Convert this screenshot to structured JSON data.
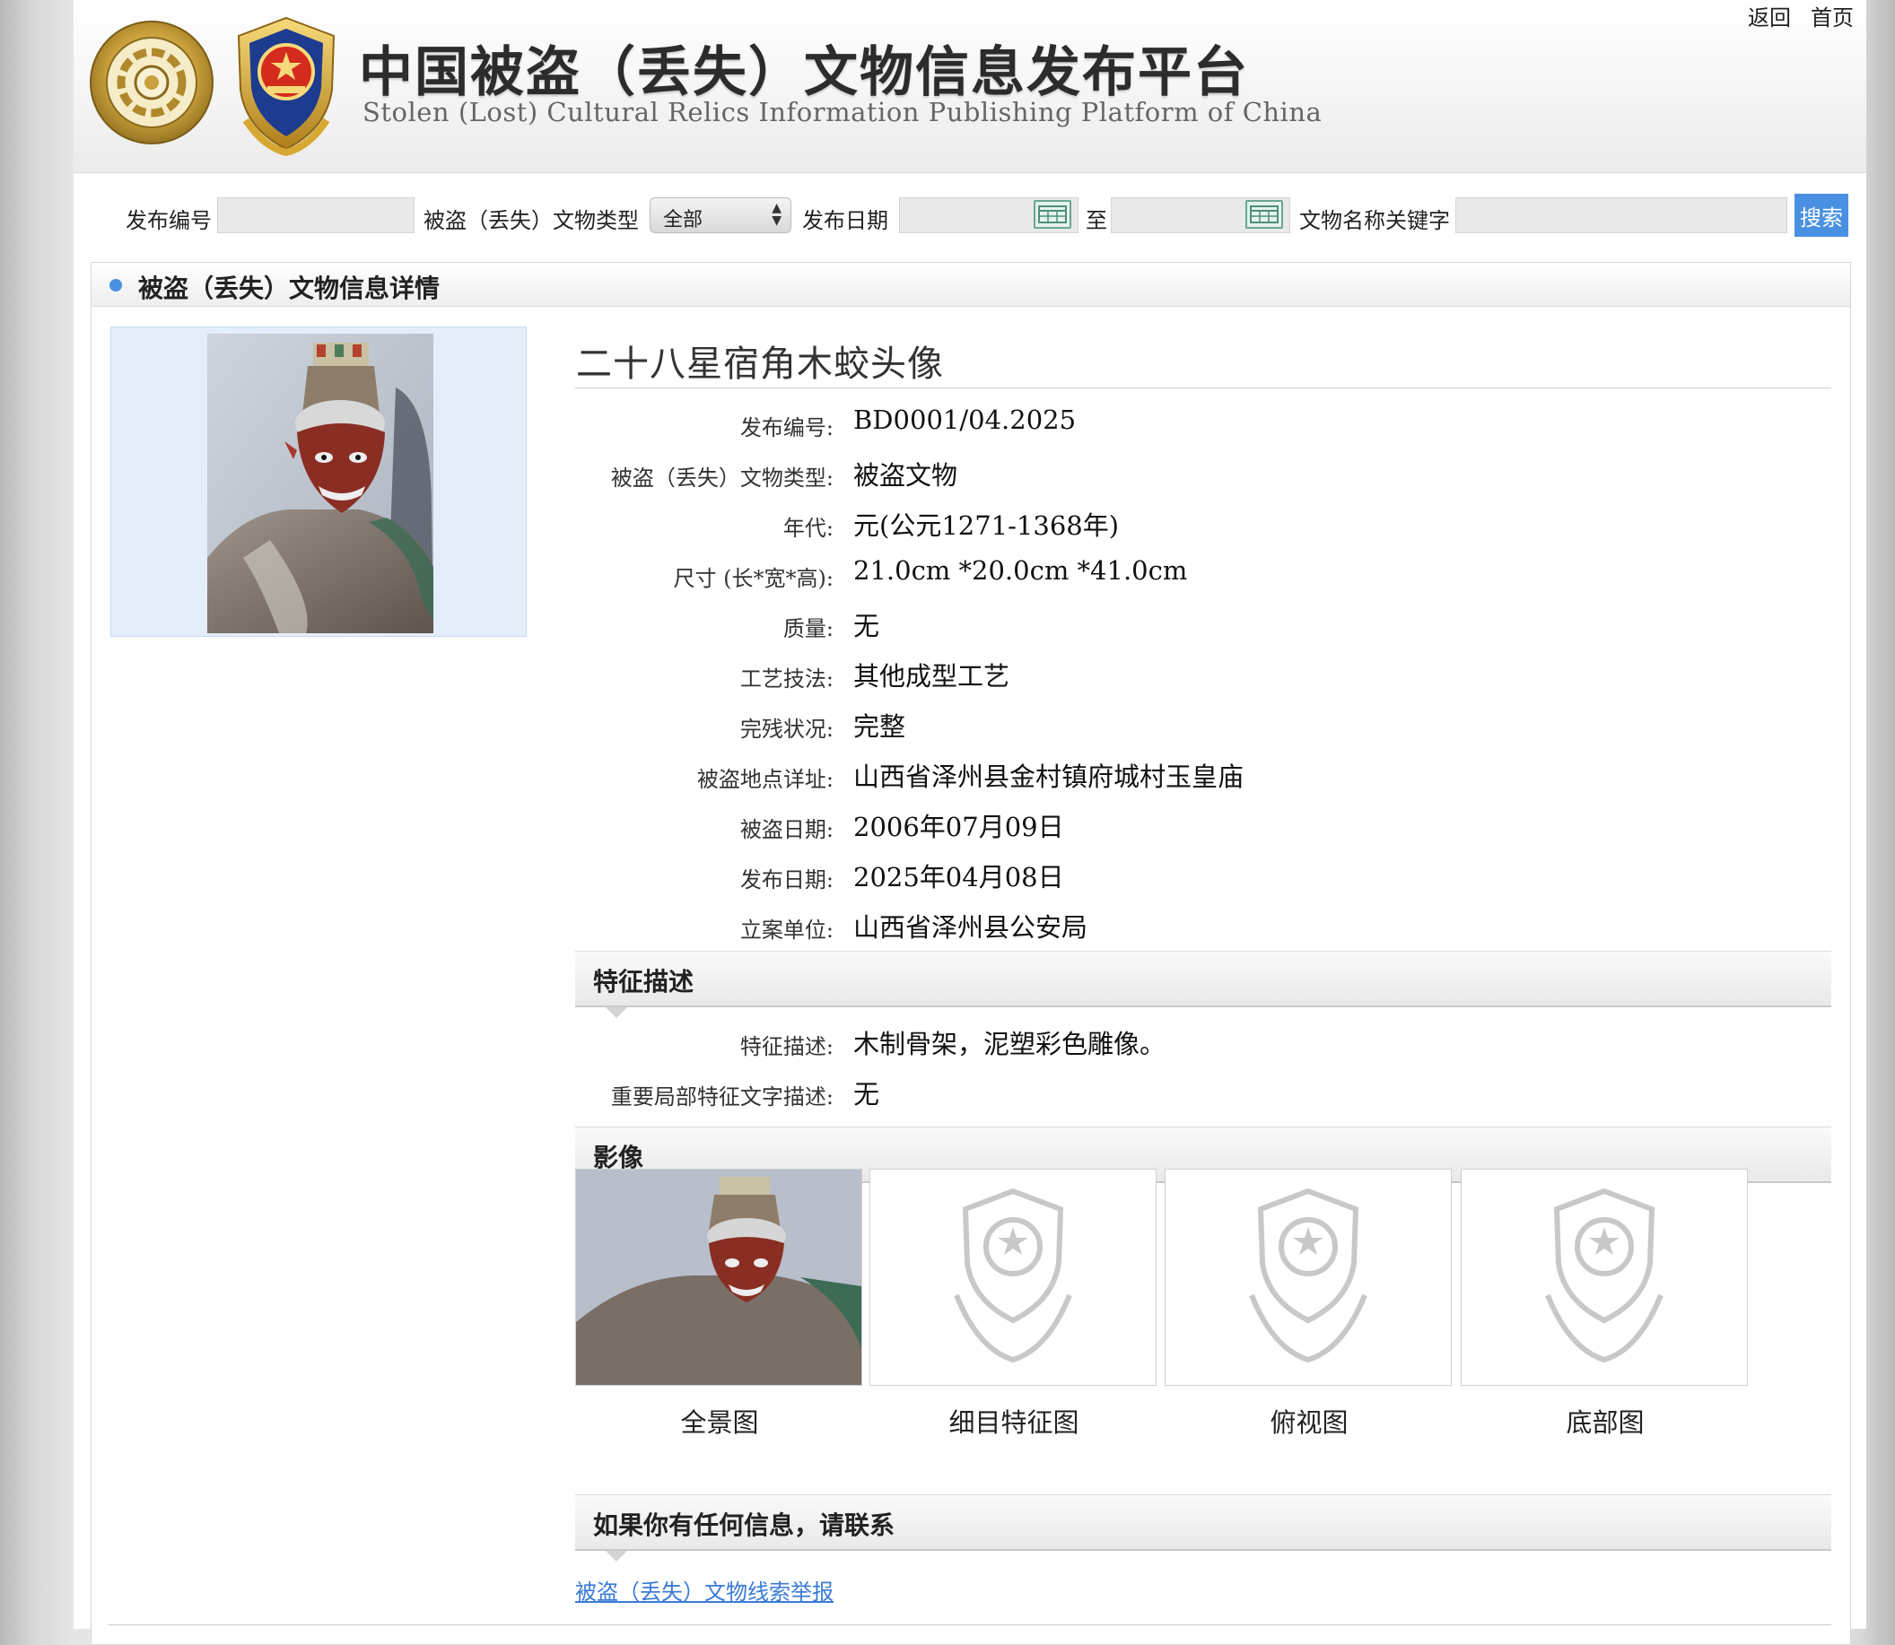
{
  "header": {
    "title_cn": "中国被盗（丢失）文物信息发布平台",
    "title_en": "Stolen (Lost) Cultural Relics Information Publishing Platform of China",
    "links": {
      "back": "返回",
      "home": "首页"
    }
  },
  "search": {
    "release_no_label": "发布编号",
    "release_no_value": "",
    "type_label": "被盗（丢失）文物类型",
    "type_selected": "全部",
    "date_label": "发布日期",
    "date_from": "",
    "date_to_label": "至",
    "date_to": "",
    "keyword_label": "文物名称关键字",
    "keyword_value": "",
    "button": "搜索"
  },
  "detail": {
    "section_title": "被盗（丢失）文物信息详情",
    "relic_name": "二十八星宿角木蛟头像",
    "fields": [
      {
        "label": "发布编号:",
        "value": "BD0001/04.2025"
      },
      {
        "label": "被盗（丢失）文物类型:",
        "value": "被盗文物"
      },
      {
        "label": "年代:",
        "value": "元(公元1271-1368年)"
      },
      {
        "label": "尺寸 (长*宽*高):",
        "value": "21.0cm *20.0cm *41.0cm"
      },
      {
        "label": "质量:",
        "value": "无"
      },
      {
        "label": "工艺技法:",
        "value": "其他成型工艺"
      },
      {
        "label": "完残状况:",
        "value": "完整"
      },
      {
        "label": "被盗地点详址:",
        "value": "山西省泽州县金村镇府城村玉皇庙"
      },
      {
        "label": "被盗日期:",
        "value": "2006年07月09日"
      },
      {
        "label": "发布日期:",
        "value": "2025年04月08日"
      },
      {
        "label": "立案单位:",
        "value": "山西省泽州县公安局"
      }
    ],
    "features": {
      "title": "特征描述",
      "fields": [
        {
          "label": "特征描述:",
          "value": "木制骨架，泥塑彩色雕像。"
        },
        {
          "label": "重要局部特征文字描述:",
          "value": "无"
        }
      ]
    },
    "images": {
      "title": "影像",
      "captions": [
        "全景图",
        "细目特征图",
        "俯视图",
        "底部图"
      ]
    },
    "contact": {
      "title": "如果你有任何信息，请联系",
      "link": "被盗（丢失）文物线索举报"
    }
  }
}
